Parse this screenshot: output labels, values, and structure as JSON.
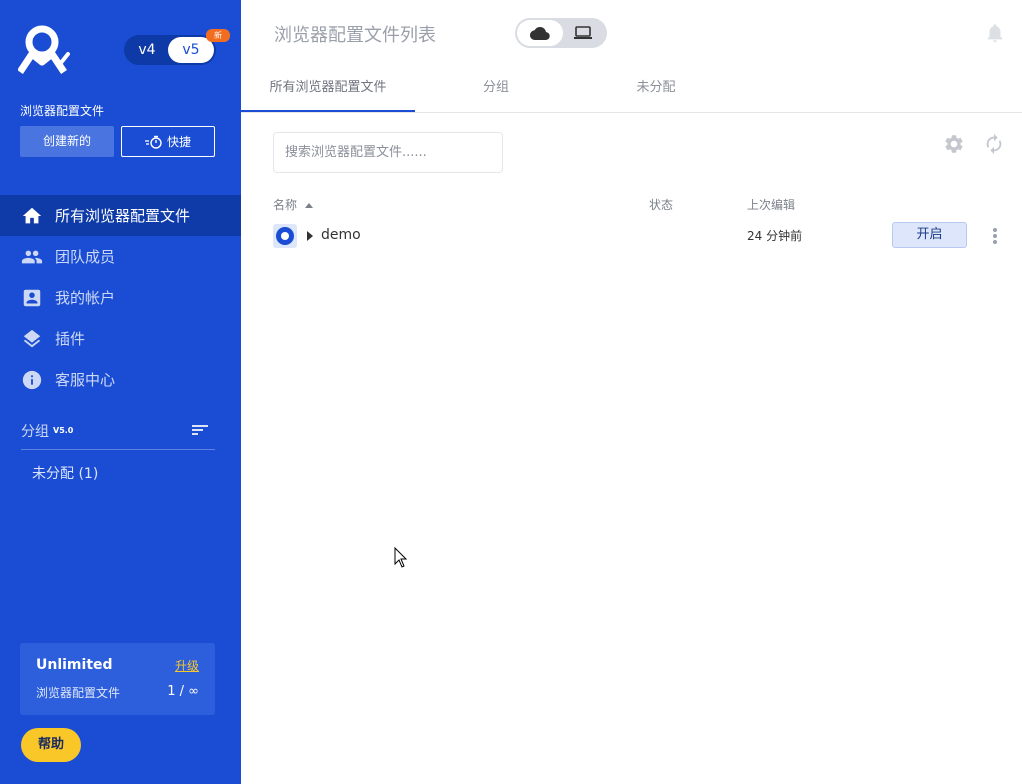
{
  "sidebar": {
    "version_v4": "v4",
    "version_v5": "v5",
    "new_badge": "新",
    "section_title": "浏览器配置文件",
    "create_label": "创建新的",
    "quick_label": "快捷",
    "nav": [
      {
        "label": "所有浏览器配置文件",
        "icon": "home-icon",
        "active": true
      },
      {
        "label": "团队成员",
        "icon": "team-icon",
        "active": false
      },
      {
        "label": "我的帐户",
        "icon": "account-icon",
        "active": false
      },
      {
        "label": "插件",
        "icon": "layers-icon",
        "active": false
      },
      {
        "label": "客服中心",
        "icon": "info-icon",
        "active": false
      }
    ],
    "groups_label": "分组",
    "groups_version": "V5.0",
    "unassigned": "未分配 (1)",
    "plan": {
      "name": "Unlimited",
      "upgrade": "升级",
      "profiles_label": "浏览器配置文件",
      "profiles_count": "1 / ∞"
    },
    "help_label": "帮助",
    "accent": "#1a4dd4",
    "highlight": "#f9c828"
  },
  "header": {
    "title": "浏览器配置文件列表"
  },
  "tabs": [
    {
      "label": "所有浏览器配置文件",
      "active": true
    },
    {
      "label": "分组",
      "active": false
    },
    {
      "label": "未分配",
      "active": false
    }
  ],
  "search": {
    "placeholder": "搜索浏览器配置文件......"
  },
  "table": {
    "columns": {
      "name": "名称",
      "status": "状态",
      "last_edit": "上次编辑"
    },
    "rows": [
      {
        "name": "demo",
        "status": "",
        "last_edit": "24 分钟前",
        "action": "开启"
      }
    ]
  }
}
